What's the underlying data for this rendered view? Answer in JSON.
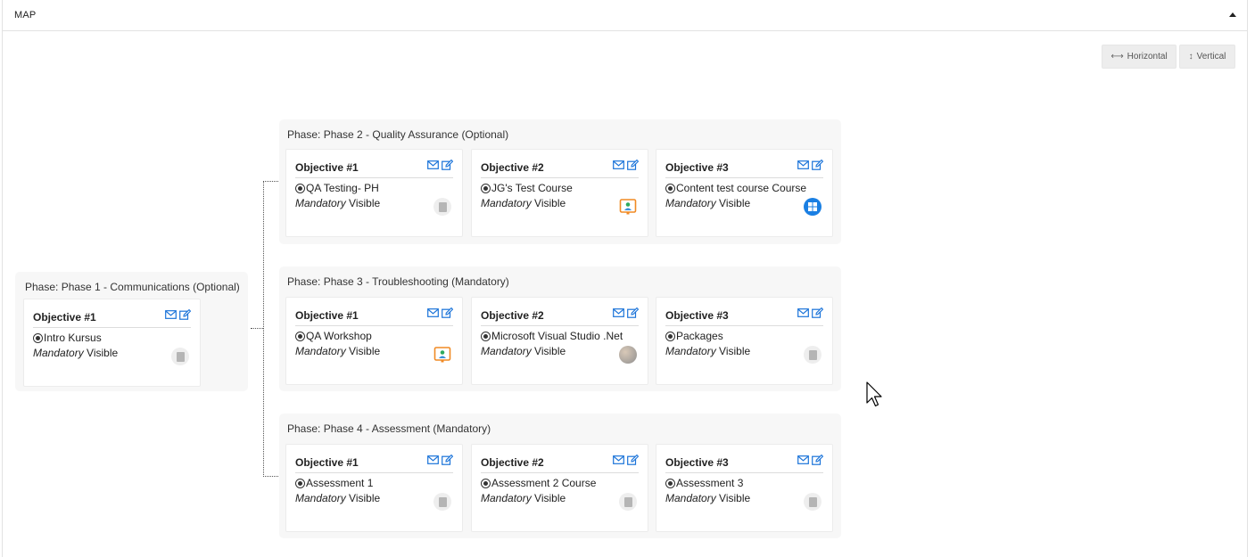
{
  "panel": {
    "title": "MAP"
  },
  "view_buttons": {
    "horizontal": "Horizontal",
    "vertical": "Vertical"
  },
  "status_mandatory": "Mandatory",
  "status_visible": "Visible",
  "phases": [
    {
      "title": "Phase: Phase 1 - Communications (Optional)",
      "objectives": [
        {
          "label": "Objective #1",
          "course": "Intro Kursus",
          "icon": "gray-course-icon"
        }
      ]
    },
    {
      "title": "Phase: Phase 2 - Quality Assurance (Optional)",
      "objectives": [
        {
          "label": "Objective #1",
          "course": "QA Testing- PH",
          "icon": "gray-course-icon"
        },
        {
          "label": "Objective #2",
          "course": "JG's Test Course",
          "icon": "presenter-icon"
        },
        {
          "label": "Objective #3",
          "course": "Content test course Course",
          "icon": "windows-icon"
        }
      ]
    },
    {
      "title": "Phase: Phase 3 - Troubleshooting (Mandatory)",
      "objectives": [
        {
          "label": "Objective #1",
          "course": "QA Workshop",
          "icon": "presenter-icon"
        },
        {
          "label": "Objective #2",
          "course": "Microsoft Visual Studio .Net",
          "icon": "mosaic-course-icon"
        },
        {
          "label": "Objective #3",
          "course": "Packages",
          "icon": "gray-course-icon"
        }
      ]
    },
    {
      "title": "Phase: Phase 4 - Assessment (Mandatory)",
      "objectives": [
        {
          "label": "Objective #1",
          "course": "Assessment 1",
          "icon": "gray-course-icon"
        },
        {
          "label": "Objective #2",
          "course": "Assessment 2 Course",
          "icon": "gray-course-icon"
        },
        {
          "label": "Objective #3",
          "course": "Assessment 3",
          "icon": "gray-course-icon"
        }
      ]
    }
  ],
  "colors": {
    "accent": "#1a73d9",
    "phase_bg": "#f7f7f7",
    "border": "#e2e2e2"
  }
}
